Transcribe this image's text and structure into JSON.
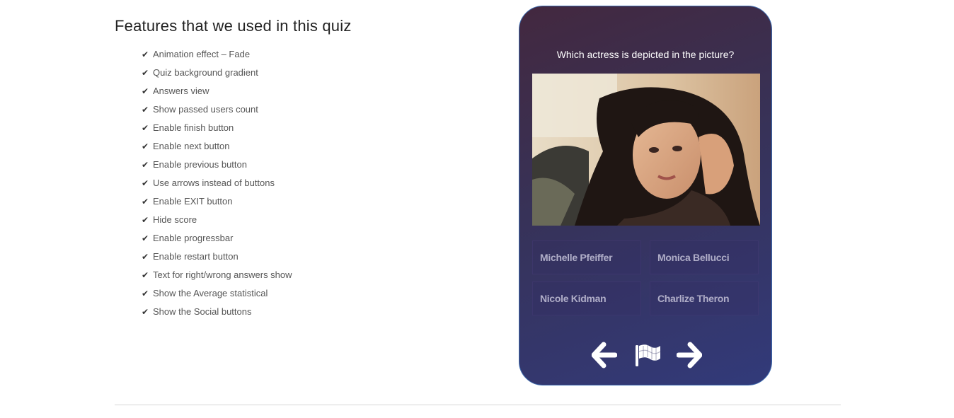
{
  "features": {
    "heading": "Features that we used in this quiz",
    "check_glyph": "✔",
    "items": [
      "Animation effect – Fade",
      "Quiz background gradient",
      "Answers view",
      "Show passed users count",
      "Enable finish button",
      "Enable next button",
      "Enable previous button",
      "Use arrows instead of buttons",
      "Enable EXIT button",
      "Hide score",
      "Enable progressbar",
      "Enable restart button",
      "Text for right/wrong answers show",
      "Show the Average statistical",
      "Show the Social buttons"
    ]
  },
  "quiz": {
    "question": "Which actress is depicted in the picture?",
    "answers": [
      "Michelle Pfeiffer",
      "Monica Bellucci",
      "Nicole Kidman",
      "Charlize Theron"
    ],
    "nav": {
      "prev_icon": "arrow-left-icon",
      "finish_icon": "flag-icon",
      "next_icon": "arrow-right-icon"
    },
    "colors": {
      "gradient_start": "#43283f",
      "gradient_end": "#323a7a",
      "border": "#3d6bb0"
    }
  }
}
